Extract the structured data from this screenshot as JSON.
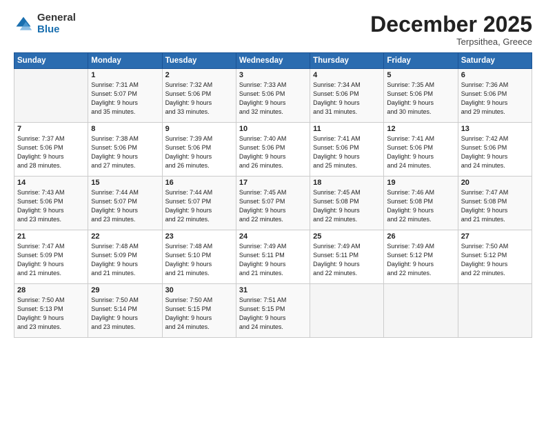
{
  "logo": {
    "general": "General",
    "blue": "Blue"
  },
  "header": {
    "month": "December 2025",
    "location": "Terpsithea, Greece"
  },
  "weekdays": [
    "Sunday",
    "Monday",
    "Tuesday",
    "Wednesday",
    "Thursday",
    "Friday",
    "Saturday"
  ],
  "weeks": [
    [
      {
        "day": "",
        "info": ""
      },
      {
        "day": "1",
        "info": "Sunrise: 7:31 AM\nSunset: 5:07 PM\nDaylight: 9 hours\nand 35 minutes."
      },
      {
        "day": "2",
        "info": "Sunrise: 7:32 AM\nSunset: 5:06 PM\nDaylight: 9 hours\nand 33 minutes."
      },
      {
        "day": "3",
        "info": "Sunrise: 7:33 AM\nSunset: 5:06 PM\nDaylight: 9 hours\nand 32 minutes."
      },
      {
        "day": "4",
        "info": "Sunrise: 7:34 AM\nSunset: 5:06 PM\nDaylight: 9 hours\nand 31 minutes."
      },
      {
        "day": "5",
        "info": "Sunrise: 7:35 AM\nSunset: 5:06 PM\nDaylight: 9 hours\nand 30 minutes."
      },
      {
        "day": "6",
        "info": "Sunrise: 7:36 AM\nSunset: 5:06 PM\nDaylight: 9 hours\nand 29 minutes."
      }
    ],
    [
      {
        "day": "7",
        "info": "Sunrise: 7:37 AM\nSunset: 5:06 PM\nDaylight: 9 hours\nand 28 minutes."
      },
      {
        "day": "8",
        "info": "Sunrise: 7:38 AM\nSunset: 5:06 PM\nDaylight: 9 hours\nand 27 minutes."
      },
      {
        "day": "9",
        "info": "Sunrise: 7:39 AM\nSunset: 5:06 PM\nDaylight: 9 hours\nand 26 minutes."
      },
      {
        "day": "10",
        "info": "Sunrise: 7:40 AM\nSunset: 5:06 PM\nDaylight: 9 hours\nand 26 minutes."
      },
      {
        "day": "11",
        "info": "Sunrise: 7:41 AM\nSunset: 5:06 PM\nDaylight: 9 hours\nand 25 minutes."
      },
      {
        "day": "12",
        "info": "Sunrise: 7:41 AM\nSunset: 5:06 PM\nDaylight: 9 hours\nand 24 minutes."
      },
      {
        "day": "13",
        "info": "Sunrise: 7:42 AM\nSunset: 5:06 PM\nDaylight: 9 hours\nand 24 minutes."
      }
    ],
    [
      {
        "day": "14",
        "info": "Sunrise: 7:43 AM\nSunset: 5:06 PM\nDaylight: 9 hours\nand 23 minutes."
      },
      {
        "day": "15",
        "info": "Sunrise: 7:44 AM\nSunset: 5:07 PM\nDaylight: 9 hours\nand 23 minutes."
      },
      {
        "day": "16",
        "info": "Sunrise: 7:44 AM\nSunset: 5:07 PM\nDaylight: 9 hours\nand 22 minutes."
      },
      {
        "day": "17",
        "info": "Sunrise: 7:45 AM\nSunset: 5:07 PM\nDaylight: 9 hours\nand 22 minutes."
      },
      {
        "day": "18",
        "info": "Sunrise: 7:45 AM\nSunset: 5:08 PM\nDaylight: 9 hours\nand 22 minutes."
      },
      {
        "day": "19",
        "info": "Sunrise: 7:46 AM\nSunset: 5:08 PM\nDaylight: 9 hours\nand 22 minutes."
      },
      {
        "day": "20",
        "info": "Sunrise: 7:47 AM\nSunset: 5:08 PM\nDaylight: 9 hours\nand 21 minutes."
      }
    ],
    [
      {
        "day": "21",
        "info": "Sunrise: 7:47 AM\nSunset: 5:09 PM\nDaylight: 9 hours\nand 21 minutes."
      },
      {
        "day": "22",
        "info": "Sunrise: 7:48 AM\nSunset: 5:09 PM\nDaylight: 9 hours\nand 21 minutes."
      },
      {
        "day": "23",
        "info": "Sunrise: 7:48 AM\nSunset: 5:10 PM\nDaylight: 9 hours\nand 21 minutes."
      },
      {
        "day": "24",
        "info": "Sunrise: 7:49 AM\nSunset: 5:11 PM\nDaylight: 9 hours\nand 21 minutes."
      },
      {
        "day": "25",
        "info": "Sunrise: 7:49 AM\nSunset: 5:11 PM\nDaylight: 9 hours\nand 22 minutes."
      },
      {
        "day": "26",
        "info": "Sunrise: 7:49 AM\nSunset: 5:12 PM\nDaylight: 9 hours\nand 22 minutes."
      },
      {
        "day": "27",
        "info": "Sunrise: 7:50 AM\nSunset: 5:12 PM\nDaylight: 9 hours\nand 22 minutes."
      }
    ],
    [
      {
        "day": "28",
        "info": "Sunrise: 7:50 AM\nSunset: 5:13 PM\nDaylight: 9 hours\nand 23 minutes."
      },
      {
        "day": "29",
        "info": "Sunrise: 7:50 AM\nSunset: 5:14 PM\nDaylight: 9 hours\nand 23 minutes."
      },
      {
        "day": "30",
        "info": "Sunrise: 7:50 AM\nSunset: 5:15 PM\nDaylight: 9 hours\nand 24 minutes."
      },
      {
        "day": "31",
        "info": "Sunrise: 7:51 AM\nSunset: 5:15 PM\nDaylight: 9 hours\nand 24 minutes."
      },
      {
        "day": "",
        "info": ""
      },
      {
        "day": "",
        "info": ""
      },
      {
        "day": "",
        "info": ""
      }
    ]
  ]
}
